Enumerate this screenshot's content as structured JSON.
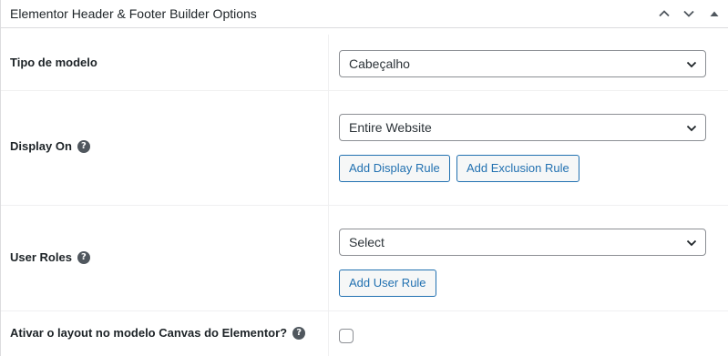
{
  "header": {
    "title": "Elementor Header & Footer Builder Options"
  },
  "fields": {
    "template_type": {
      "label": "Tipo de modelo",
      "value": "Cabeçalho"
    },
    "display_on": {
      "label": "Display On",
      "help": "?",
      "value": "Entire Website",
      "add_display_rule": "Add Display Rule",
      "add_exclusion_rule": "Add Exclusion Rule"
    },
    "user_roles": {
      "label": "User Roles",
      "help": "?",
      "value": "Select",
      "add_user_rule": "Add User Rule"
    },
    "canvas_layout": {
      "label": "Ativar o layout no modelo Canvas do Elementor?",
      "help": "?",
      "checked": false
    }
  },
  "colors": {
    "accent": "#2271b1",
    "text": "#1d2327",
    "border": "#8c8f94",
    "divider": "#f0f0f1"
  }
}
